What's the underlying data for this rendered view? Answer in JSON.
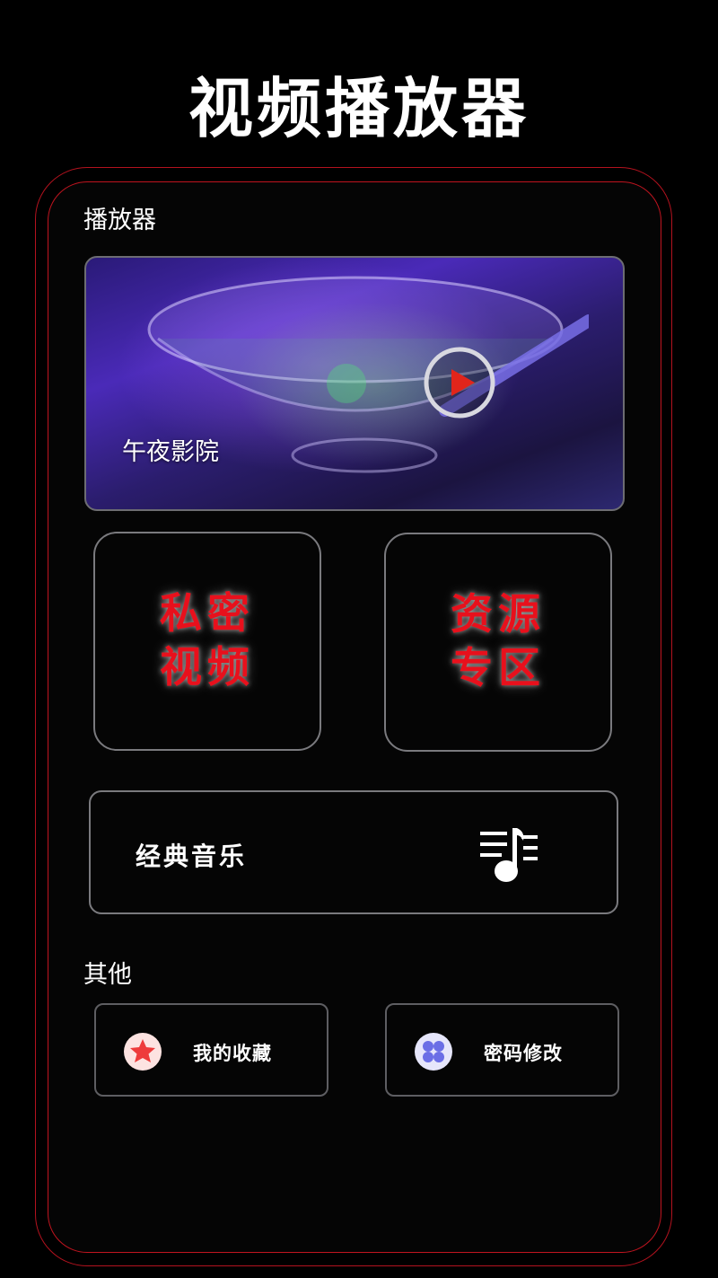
{
  "header": {
    "title": "视频播放器"
  },
  "sections": {
    "player_label": "播放器",
    "other_label": "其他"
  },
  "banner": {
    "title": "午夜影院",
    "play_icon": "play-circle-icon"
  },
  "tiles": [
    {
      "line1": "私密",
      "line2": "视频"
    },
    {
      "line1": "资源",
      "line2": "专区"
    }
  ],
  "music": {
    "label": "经典音乐",
    "icon": "music-list-icon"
  },
  "other_items": [
    {
      "label": "我的收藏",
      "icon": "star-icon"
    },
    {
      "label": "密码修改",
      "icon": "grid-icon"
    }
  ],
  "colors": {
    "accent_red": "#e8101c",
    "frame_red": "#c0141f",
    "background": "#000000"
  }
}
